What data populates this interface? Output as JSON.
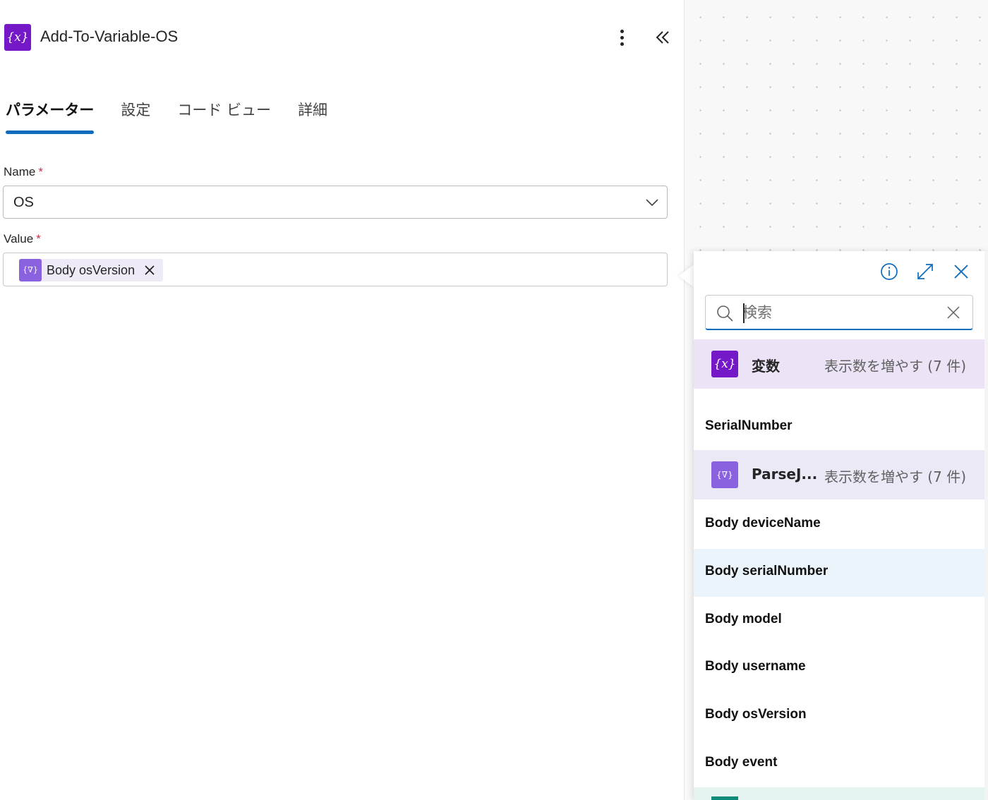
{
  "header": {
    "icon": "variable-icon",
    "icon_glyph": "{x}",
    "title": "Add-To-Variable-OS"
  },
  "tabs": [
    {
      "label": "パラメーター",
      "active": true
    },
    {
      "label": "設定",
      "active": false
    },
    {
      "label": "コード ビュー",
      "active": false
    },
    {
      "label": "詳細",
      "active": false
    }
  ],
  "form": {
    "name": {
      "label": "Name",
      "required_mark": "*",
      "value": "OS"
    },
    "value": {
      "label": "Value",
      "required_mark": "*",
      "token": {
        "icon": "parse-json-icon",
        "icon_glyph": "{∇}",
        "text": "Body osVersion"
      }
    }
  },
  "picker": {
    "search": {
      "placeholder": "検索",
      "value": ""
    },
    "groups": [
      {
        "name": "変数",
        "icon_glyph": "{x}",
        "more": "表示数を増やす (7 件)",
        "items": [
          "SerialNumber"
        ]
      },
      {
        "name": "ParseJ...",
        "icon_glyph": "{∇}",
        "more": "表示数を増やす (7 件)",
        "items": [
          "Body deviceName",
          "Body serialNumber",
          "Body model",
          "Body username",
          "Body osVersion",
          "Body event"
        ]
      }
    ]
  },
  "colors": {
    "variable_accent": "#7518c7",
    "parse_json_accent": "#8a62e0",
    "primary": "#0f6cbd",
    "required": "#c4314b"
  }
}
